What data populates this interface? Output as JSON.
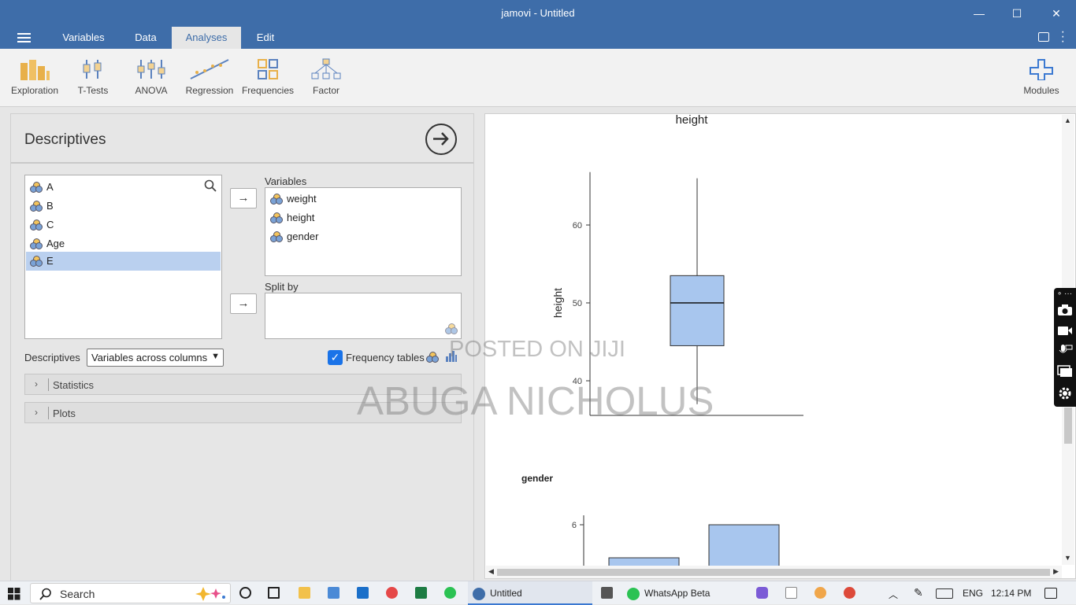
{
  "window": {
    "title": "jamovi - Untitled",
    "minimize": "—",
    "maximize": "☐",
    "close": "✕"
  },
  "menu": {
    "tabs": [
      "Variables",
      "Data",
      "Analyses",
      "Edit"
    ],
    "active": "Analyses"
  },
  "ribbon": {
    "items": [
      "Exploration",
      "T-Tests",
      "ANOVA",
      "Regression",
      "Frequencies",
      "Factor"
    ],
    "modules": "Modules"
  },
  "descriptives": {
    "title": "Descriptives",
    "available_vars": [
      "A",
      "B",
      "C",
      "Age",
      "E"
    ],
    "selected_available": "E",
    "variables_label": "Variables",
    "variables": [
      "weight",
      "height",
      "gender"
    ],
    "split_by_label": "Split by",
    "descriptives_label": "Descriptives",
    "descriptives_option": "Variables across columns",
    "frequency_tables_label": "Frequency tables",
    "frequency_tables_checked": true,
    "sections": [
      "Statistics",
      "Plots"
    ]
  },
  "results": {
    "boxplot": {
      "title": "height",
      "ylabel": "height",
      "yticks": [
        "60",
        "50",
        "40"
      ]
    },
    "gender_plot": {
      "title": "gender",
      "ytick": "6"
    }
  },
  "chart_data": [
    {
      "type": "box",
      "title": "height",
      "xlabel": "",
      "ylabel": "height",
      "ylim": [
        35.5,
        67
      ],
      "yticks": [
        40,
        50,
        60
      ],
      "series": [
        {
          "min": 37,
          "q1": 44.5,
          "median": 50,
          "q3": 53.5,
          "max": 66
        }
      ],
      "color": "#a8c6ee"
    },
    {
      "type": "bar",
      "title": "gender",
      "ylabel": "",
      "yticks": [
        6
      ],
      "color": "#a8c6ee"
    }
  ],
  "watermarks": [
    "POSTED ON JIJI",
    "ABUGA NICHOLUS"
  ],
  "taskbar": {
    "search": "Search",
    "apps": [
      "Untitled",
      "WhatsApp Beta"
    ],
    "lang": "ENG",
    "time": "12:14 PM"
  },
  "colors": {
    "titlebar": "#3e6da9",
    "accent": "#1a73e8",
    "plot_fill": "#a8c6ee",
    "selected_row": "#bad0ef"
  }
}
